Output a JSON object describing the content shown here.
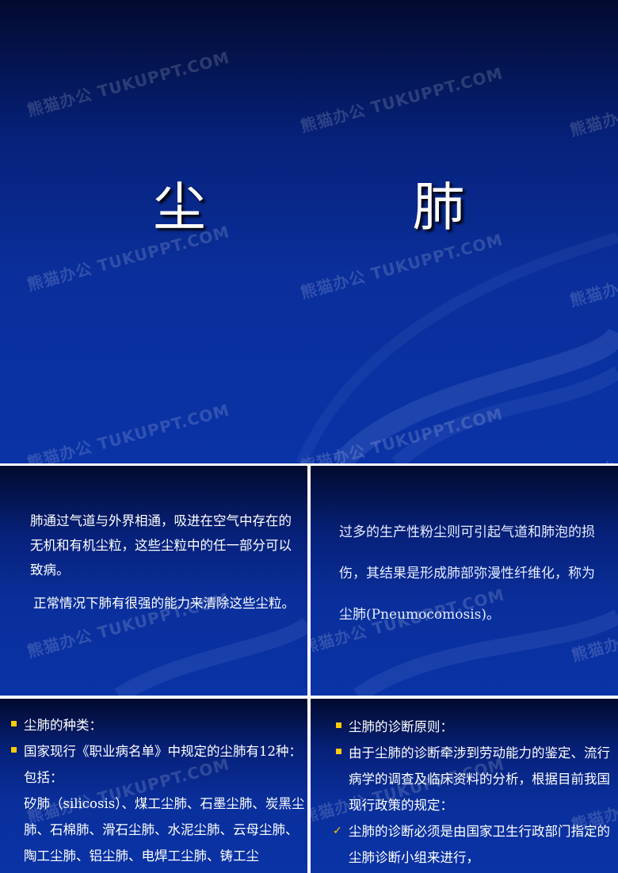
{
  "watermark": "熊猫办公 TUKUPPT.COM",
  "colors": {
    "bullet": "#ffcc00",
    "text": "#ffffff",
    "background": "#0a2f9c"
  },
  "slide1": {
    "title": "尘 肺"
  },
  "slide2": {
    "para1": "肺通过气道与外界相通，吸进在空气中存在的无机和有机尘粒，这些尘粒中的任一部分可以致病。",
    "para2": "正常情况下肺有很强的能力来清除这些尘粒。"
  },
  "slide3": {
    "text": "过多的生产性粉尘则可引起气道和肺泡的损伤，其结果是形成肺部弥漫性纤维化，称为尘肺(Pneumocomosis)。"
  },
  "slide4": {
    "items": [
      {
        "text": "尘肺的种类：",
        "bullet": "square"
      },
      {
        "text": "国家现行《职业病名单》中规定的尘肺有12种：包括：",
        "bullet": "square"
      },
      {
        "text": "矽肺（silicosis）、煤工尘肺、石墨尘肺、炭黑尘肺、石棉肺、滑石尘肺、水泥尘肺、云母尘肺、陶工尘肺、铝尘肺、电焊工尘肺、铸工尘",
        "bullet": "none"
      }
    ]
  },
  "slide5": {
    "items": [
      {
        "text": "尘肺的诊断原则：",
        "bullet": "square"
      },
      {
        "text": "由于尘肺的诊断牵涉到劳动能力的鉴定、流行病学的调查及临床资料的分析，根据目前我国现行政策的规定：",
        "bullet": "square"
      },
      {
        "text": "尘肺的诊断必须是由国家卫生行政部门指定的尘肺诊断小组来进行，",
        "bullet": "check"
      }
    ]
  }
}
